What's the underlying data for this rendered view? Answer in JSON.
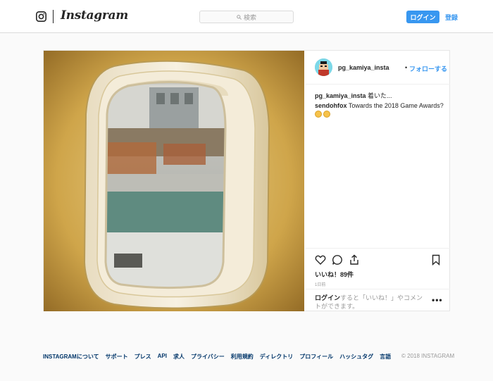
{
  "header": {
    "logo_text": "Instagram",
    "search_placeholder": "検索",
    "login_label": "ログイン",
    "signup_label": "登録"
  },
  "post": {
    "username": "pg_kamiya_insta",
    "separator": "•",
    "follow_label": "フォローする",
    "caption": {
      "user": "pg_kamiya_insta",
      "text": " 着いた..."
    },
    "comment": {
      "user": "sendohfox",
      "text": " Towards the 2018 Game Awards?"
    },
    "likes": "いいね！89件",
    "time": "1日前",
    "login_prompt": {
      "link": "ログイン",
      "text": "すると「いいね！」やコメントができます。"
    },
    "more": "•••"
  },
  "footer": {
    "links": [
      "INSTAGRAMについて",
      "サポート",
      "プレス",
      "API",
      "求人",
      "プライバシー",
      "利用規約",
      "ディレクトリ",
      "プロフィール",
      "ハッシュタグ",
      "言語"
    ],
    "copyright": "© 2018 INSTAGRAM"
  },
  "colors": {
    "accent": "#3897f0",
    "link": "#003569",
    "border": "#dbdbdb"
  }
}
